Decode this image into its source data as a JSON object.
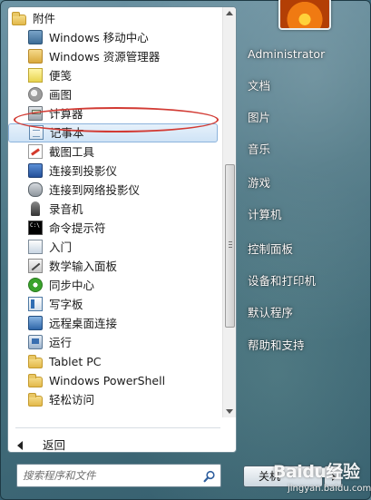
{
  "all_programs": {
    "items": [
      {
        "label": "附件",
        "icon": "folder-icon",
        "level": "root"
      },
      {
        "label": "Windows 移动中心",
        "icon": "mobility-center-icon",
        "level": "sub"
      },
      {
        "label": "Windows 资源管理器",
        "icon": "explorer-icon",
        "level": "sub"
      },
      {
        "label": "便笺",
        "icon": "sticky-notes-icon",
        "level": "sub"
      },
      {
        "label": "画图",
        "icon": "paint-icon",
        "level": "sub"
      },
      {
        "label": "计算器",
        "icon": "calculator-icon",
        "level": "sub",
        "annotated": true
      },
      {
        "label": "记事本",
        "icon": "notepad-icon",
        "level": "sub",
        "highlighted": true
      },
      {
        "label": "截图工具",
        "icon": "snipping-tool-icon",
        "level": "sub"
      },
      {
        "label": "连接到投影仪",
        "icon": "projector-icon",
        "level": "sub"
      },
      {
        "label": "连接到网络投影仪",
        "icon": "network-projector-icon",
        "level": "sub"
      },
      {
        "label": "录音机",
        "icon": "sound-recorder-icon",
        "level": "sub"
      },
      {
        "label": "命令提示符",
        "icon": "command-prompt-icon",
        "level": "sub"
      },
      {
        "label": "入门",
        "icon": "getting-started-icon",
        "level": "sub"
      },
      {
        "label": "数学输入面板",
        "icon": "math-input-icon",
        "level": "sub"
      },
      {
        "label": "同步中心",
        "icon": "sync-center-icon",
        "level": "sub"
      },
      {
        "label": "写字板",
        "icon": "wordpad-icon",
        "level": "sub"
      },
      {
        "label": "远程桌面连接",
        "icon": "remote-desktop-icon",
        "level": "sub"
      },
      {
        "label": "运行",
        "icon": "run-icon",
        "level": "sub"
      },
      {
        "label": "Tablet PC",
        "icon": "folder-icon",
        "level": "sub"
      },
      {
        "label": "Windows PowerShell",
        "icon": "folder-icon",
        "level": "sub"
      },
      {
        "label": "轻松访问",
        "icon": "folder-icon",
        "level": "sub"
      }
    ],
    "back_label": "返回"
  },
  "search": {
    "placeholder": "搜索程序和文件"
  },
  "right_panel": {
    "items": [
      {
        "label": "Administrator"
      },
      {
        "label": "文档"
      },
      {
        "label": "图片"
      },
      {
        "label": "音乐"
      },
      {
        "label": "游戏"
      },
      {
        "label": "计算机"
      },
      {
        "label": "控制面板"
      },
      {
        "label": "设备和打印机"
      },
      {
        "label": "默认程序"
      },
      {
        "label": "帮助和支持"
      }
    ]
  },
  "shutdown": {
    "label": "关机"
  },
  "watermark": {
    "logo": "Baidu经验",
    "url": "jingyan.baidu.com"
  },
  "colors": {
    "annotation": "#d23b34",
    "highlight": "#cfe3f6",
    "frame": "#46717f"
  }
}
